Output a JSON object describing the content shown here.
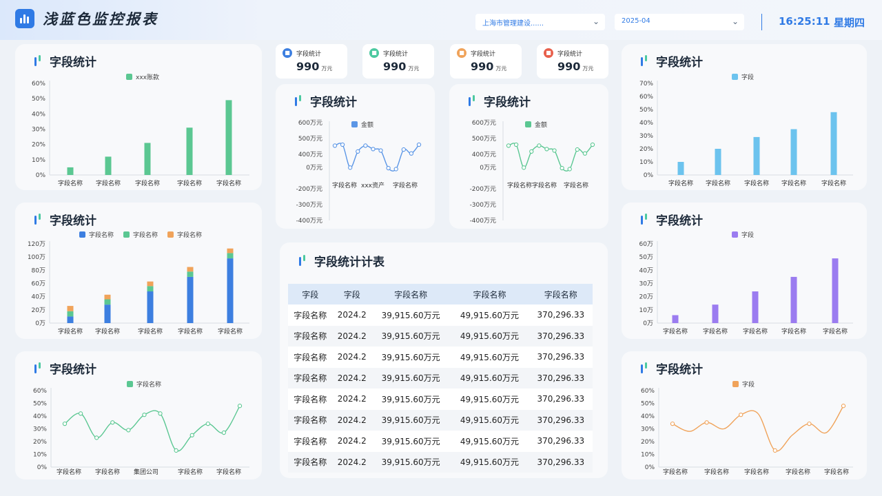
{
  "header": {
    "title": "浅蓝色监控报表",
    "region_select": "上海市管理建设......",
    "date_select": "2025-04",
    "time": "16:25:11",
    "weekday": "星期四"
  },
  "kpis": [
    {
      "label": "字段统计",
      "value": "990",
      "unit": "万元",
      "color": "#3d7fe0",
      "icon": "lock-icon"
    },
    {
      "label": "字段统计",
      "value": "990",
      "unit": "万元",
      "color": "#4cc9a0",
      "icon": "document-icon"
    },
    {
      "label": "字段统计",
      "value": "990",
      "unit": "万元",
      "color": "#f0a35a",
      "icon": "money-bag-icon"
    },
    {
      "label": "字段统计",
      "value": "990",
      "unit": "万元",
      "color": "#e8604c",
      "icon": "calendar-icon"
    }
  ],
  "panels": {
    "left_top": {
      "title": "字段统计"
    },
    "left_mid": {
      "title": "字段统计"
    },
    "left_bot": {
      "title": "字段统计"
    },
    "center_left": {
      "title": "字段统计"
    },
    "center_right": {
      "title": "字段统计"
    },
    "right_top": {
      "title": "字段统计"
    },
    "right_mid": {
      "title": "字段统计"
    },
    "right_bot": {
      "title": "字段统计"
    },
    "table": {
      "title": "字段统计计表"
    }
  },
  "table": {
    "columns": [
      "字段",
      "字段",
      "字段名称",
      "字段名称",
      "字段名称"
    ],
    "rows": [
      [
        "字段名称",
        "2024.2",
        "39,915.60万元",
        "49,915.60万元",
        "370,296.33"
      ],
      [
        "字段名称",
        "2024.2",
        "39,915.60万元",
        "49,915.60万元",
        "370,296.33"
      ],
      [
        "字段名称",
        "2024.2",
        "39,915.60万元",
        "49,915.60万元",
        "370,296.33"
      ],
      [
        "字段名称",
        "2024.2",
        "39,915.60万元",
        "49,915.60万元",
        "370,296.33"
      ],
      [
        "字段名称",
        "2024.2",
        "39,915.60万元",
        "49,915.60万元",
        "370,296.33"
      ],
      [
        "字段名称",
        "2024.2",
        "39,915.60万元",
        "49,915.60万元",
        "370,296.33"
      ],
      [
        "字段名称",
        "2024.2",
        "39,915.60万元",
        "49,915.60万元",
        "370,296.33"
      ],
      [
        "字段名称",
        "2024.2",
        "39,915.60万元",
        "49,915.60万元",
        "370,296.33"
      ]
    ]
  },
  "chart_data": [
    {
      "id": "left_top",
      "type": "bar",
      "categories": [
        "字段名称",
        "字段名称",
        "字段名称",
        "字段名称",
        "字段名称"
      ],
      "series": [
        {
          "name": "xxx账款",
          "values": [
            5,
            12,
            21,
            31,
            49
          ],
          "color": "#5bc792"
        }
      ],
      "yticks": [
        "0%",
        "10%",
        "20%",
        "30%",
        "40%",
        "50%",
        "60%"
      ],
      "ylim": [
        0,
        60
      ]
    },
    {
      "id": "left_mid",
      "type": "bar",
      "stacked": true,
      "categories": [
        "字段名称",
        "字段名称",
        "字段名称",
        "字段名称",
        "字段名称"
      ],
      "series": [
        {
          "name": "字段名称",
          "values": [
            10,
            28,
            48,
            70,
            98
          ],
          "color": "#3d7fe0"
        },
        {
          "name": "字段名称",
          "values": [
            8,
            8,
            8,
            8,
            8
          ],
          "color": "#5bc792"
        },
        {
          "name": "字段名称",
          "values": [
            8,
            7,
            7,
            7,
            7
          ],
          "color": "#f0a35a"
        }
      ],
      "yticks": [
        "0万",
        "20万",
        "40万",
        "60万",
        "80万",
        "100万",
        "120万"
      ],
      "ylim": [
        0,
        120
      ]
    },
    {
      "id": "left_bot",
      "type": "line",
      "smooth": true,
      "categories": [
        "字段名称",
        "字段名称",
        "集团公司",
        "字段名称",
        "字段名称"
      ],
      "series": [
        {
          "name": "字段名称",
          "values": [
            34,
            42,
            23,
            35,
            29,
            41,
            42,
            13,
            25,
            34,
            27,
            48
          ],
          "color": "#5bc792"
        }
      ],
      "yticks": [
        "0%",
        "10%",
        "20%",
        "30%",
        "40%",
        "50%",
        "60%"
      ],
      "ylim": [
        0,
        60
      ]
    },
    {
      "id": "center_left",
      "type": "line",
      "categories": [
        "字段名称",
        "xxx资产",
        "字段名称"
      ],
      "series": [
        {
          "name": "金额",
          "values": [
            460,
            480,
            80,
            340,
            460,
            390,
            360,
            70,
            50,
            380,
            300,
            480
          ],
          "color": "#5b96e6"
        }
      ],
      "yticks": [
        "-400万元",
        "-300万元",
        "-200万元",
        "0万元",
        "400万元",
        "500万元",
        "600万元"
      ],
      "ylim": [
        -400,
        600
      ]
    },
    {
      "id": "center_right",
      "type": "line",
      "categories": [
        "字段名称",
        "字段名称",
        "字段名称"
      ],
      "series": [
        {
          "name": "金额",
          "values": [
            460,
            480,
            80,
            340,
            460,
            390,
            360,
            70,
            50,
            380,
            300,
            480
          ],
          "color": "#5bc792"
        }
      ],
      "yticks": [
        "-400万元",
        "-300万元",
        "-200万元",
        "0万元",
        "400万元",
        "500万元",
        "600万元"
      ],
      "ylim": [
        -400,
        600
      ]
    },
    {
      "id": "right_top",
      "type": "bar",
      "categories": [
        "字段名称",
        "字段名称",
        "字段名称",
        "字段名称",
        "字段名称"
      ],
      "series": [
        {
          "name": "字段",
          "values": [
            10,
            20,
            29,
            35,
            48
          ],
          "color": "#6cc3ee"
        }
      ],
      "yticks": [
        "0%",
        "10%",
        "20%",
        "30%",
        "40%",
        "50%",
        "60%",
        "70%"
      ],
      "ylim": [
        0,
        70
      ]
    },
    {
      "id": "right_mid",
      "type": "bar",
      "categories": [
        "字段名称",
        "字段名称",
        "字段名称",
        "字段名称",
        "字段名称"
      ],
      "series": [
        {
          "name": "字段",
          "values": [
            6,
            14,
            24,
            35,
            49
          ],
          "color": "#9b7cf0"
        }
      ],
      "yticks": [
        "0万",
        "10万",
        "20万",
        "30万",
        "40万",
        "50万",
        "60万"
      ],
      "ylim": [
        0,
        60
      ]
    },
    {
      "id": "right_bot",
      "type": "line",
      "smooth": true,
      "categories": [
        "字段名称",
        "字段名称",
        "字段名称",
        "字段名称",
        "字段名称"
      ],
      "series": [
        {
          "name": "字段",
          "values": [
            34,
            28,
            35,
            30,
            41,
            42,
            13,
            25,
            34,
            27,
            48
          ],
          "color": "#f0a35a"
        }
      ],
      "yticks": [
        "0%",
        "10%",
        "20%",
        "30%",
        "40%",
        "50%",
        "60%"
      ],
      "ylim": [
        0,
        60
      ]
    }
  ]
}
